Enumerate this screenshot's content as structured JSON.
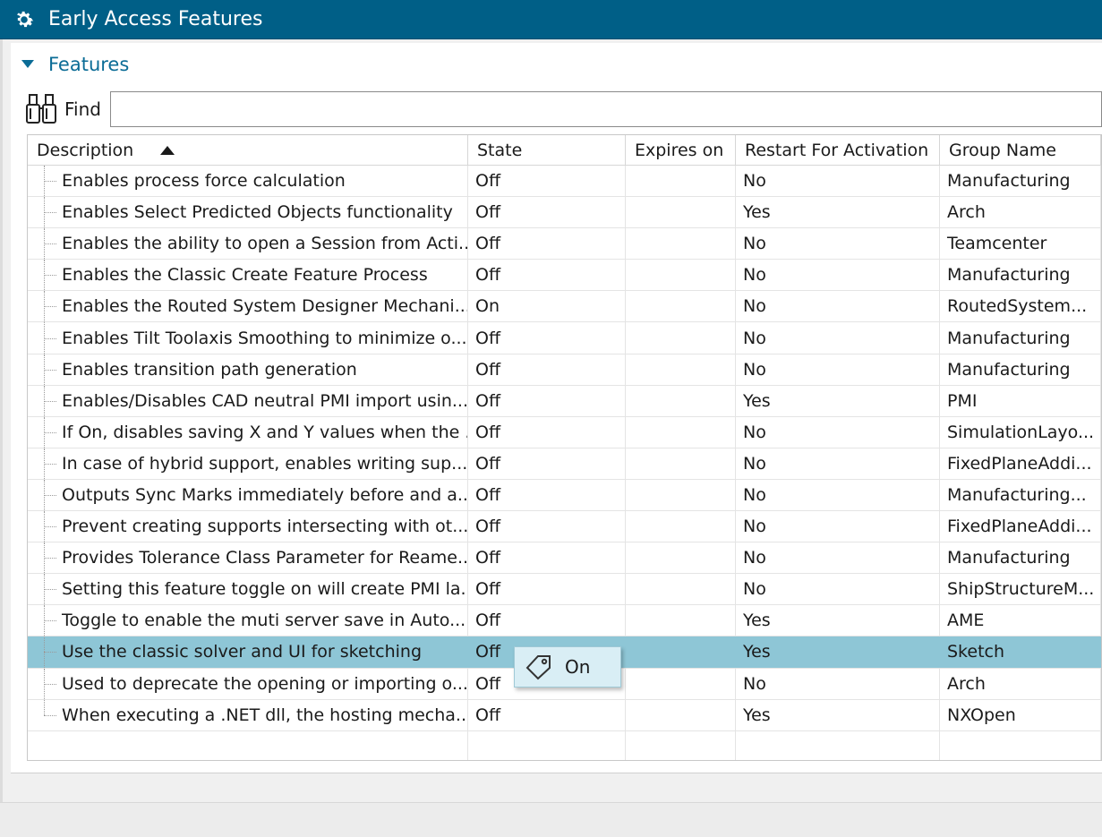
{
  "window": {
    "title": "Early Access Features"
  },
  "section": {
    "title": "Features",
    "expanded": true
  },
  "find": {
    "label": "Find",
    "value": ""
  },
  "table": {
    "columns": [
      "Description",
      "State",
      "Expires on",
      "Restart For Activation",
      "Group Name"
    ],
    "sort_column": "Description",
    "sort_direction": "ascending",
    "rows": [
      [
        "Enables process force calculation",
        "Off",
        "",
        "No",
        "Manufacturing"
      ],
      [
        "Enables Select Predicted Objects functionality",
        "Off",
        "",
        "Yes",
        "Arch"
      ],
      [
        "Enables the ability to open a Session from Acti...",
        "Off",
        "",
        "No",
        "Teamcenter"
      ],
      [
        "Enables the Classic Create Feature Process",
        "Off",
        "",
        "No",
        "Manufacturing"
      ],
      [
        "Enables the Routed System Designer Mechani...",
        "On",
        "",
        "No",
        "RoutedSystem..."
      ],
      [
        "Enables Tilt Toolaxis Smoothing to minimize o...",
        "Off",
        "",
        "No",
        "Manufacturing"
      ],
      [
        "Enables transition path generation",
        "Off",
        "",
        "No",
        "Manufacturing"
      ],
      [
        "Enables/Disables CAD neutral PMI import usin...",
        "Off",
        "",
        "Yes",
        "PMI"
      ],
      [
        "If On, disables saving X and Y values when the ...",
        "Off",
        "",
        "No",
        "SimulationLayo..."
      ],
      [
        "In case of hybrid support, enables writing sup...",
        "Off",
        "",
        "No",
        "FixedPlaneAddi..."
      ],
      [
        "Outputs Sync Marks immediately before and a...",
        "Off",
        "",
        "No",
        "Manufacturing..."
      ],
      [
        "Prevent creating supports intersecting with ot...",
        "Off",
        "",
        "No",
        "FixedPlaneAddi..."
      ],
      [
        "Provides Tolerance Class Parameter for Reame...",
        "Off",
        "",
        "No",
        "Manufacturing"
      ],
      [
        "Setting this feature toggle on will create PMI la...",
        "Off",
        "",
        "No",
        "ShipStructureM..."
      ],
      [
        "Toggle to enable the muti server save in Auto...",
        "Off",
        "",
        "Yes",
        "AME"
      ],
      [
        "Use the classic solver and UI for sketching",
        "Off",
        "",
        "Yes",
        "Sketch"
      ],
      [
        "Used to deprecate the opening or importing o...",
        "Off",
        "",
        "No",
        "Arch"
      ],
      [
        "When executing a .NET dll, the hosting mecha...",
        "Off",
        "",
        "Yes",
        "NXOpen"
      ]
    ],
    "selected_row_index": 15
  },
  "popup": {
    "label": "On",
    "icon": "tag-icon"
  },
  "colors": {
    "titlebar": "#005f87",
    "accent": "#0b6c96",
    "selection": "#8ec6d6",
    "popup": "#d9eef5"
  }
}
